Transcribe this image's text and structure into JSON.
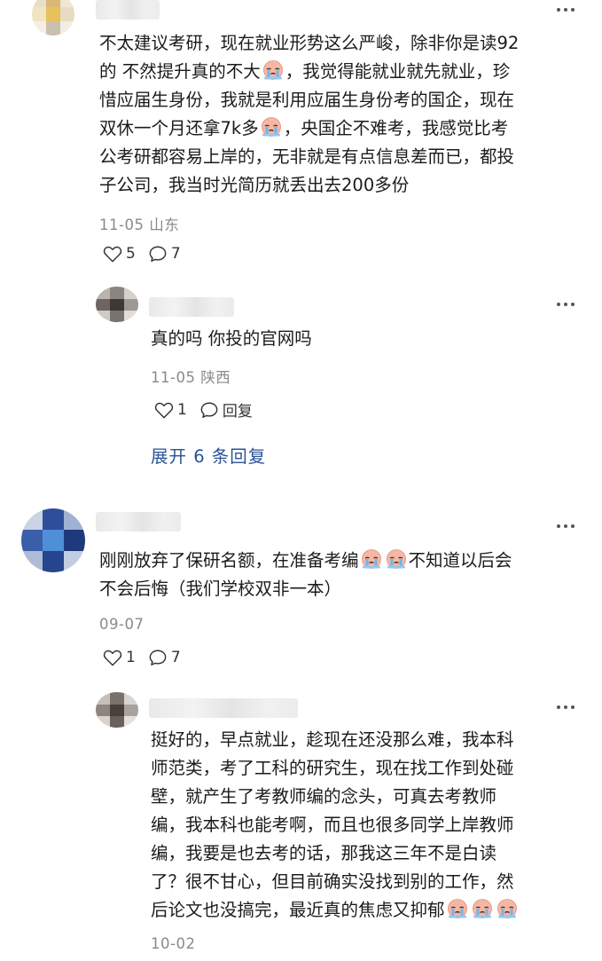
{
  "comments": [
    {
      "text_lines": [
        "不太建议考研，现在就业形势这么严峻，除非你是读92",
        "的 不然提升真的不大[emoji]，我觉得能就业就先就业，珍",
        "惜应届生身份，我就是利用应届生身份考的国企，现在",
        "双休一个月还拿7k多[emoji]，央国企不难考，我感觉比考",
        "公考研都容易上岸的，无非就是有点信息差而已，都投",
        "子公司，我当时光简历就丢出去200多份"
      ],
      "meta": "11-05 山东",
      "likes": "5",
      "comments_count": "7",
      "replies": [
        {
          "text_lines": [
            "真的吗 你投的官网吗"
          ],
          "meta": "11-05 陕西",
          "likes": "1",
          "reply_label": "回复"
        }
      ],
      "expand_label": "展开 6 条回复"
    },
    {
      "text_lines": [
        "刚刚放弃了保研名额，在准备考编[emoji][emoji]不知道以后会",
        "不会后悔（我们学校双非一本）"
      ],
      "meta": "09-07",
      "likes": "1",
      "comments_count": "7",
      "replies": [
        {
          "text_lines": [
            "挺好的，早点就业，趁现在还没那么难，我本科",
            "师范类，考了工科的研究生，现在找工作到处碰",
            "壁，就产生了考教师编的念头，可真去考教师",
            "编，我本科也能考啊，而且也很多同学上岸教师",
            "编，我要是也去考的话，那我这三年不是白读",
            "了？很不甘心，但目前确实没找到别的工作，然",
            "后论文也没搞完，最近真的焦虑又抑郁[emoji][emoji][emoji]"
          ],
          "meta": "10-02"
        }
      ]
    }
  ],
  "icons": {
    "like": "heart-outline-icon",
    "comment": "speech-bubble-icon",
    "more": "ellipsis-icon",
    "emoji": "crying-face-emoji"
  },
  "colors": {
    "link": "#2a5294",
    "meta": "#8a8a8a"
  }
}
